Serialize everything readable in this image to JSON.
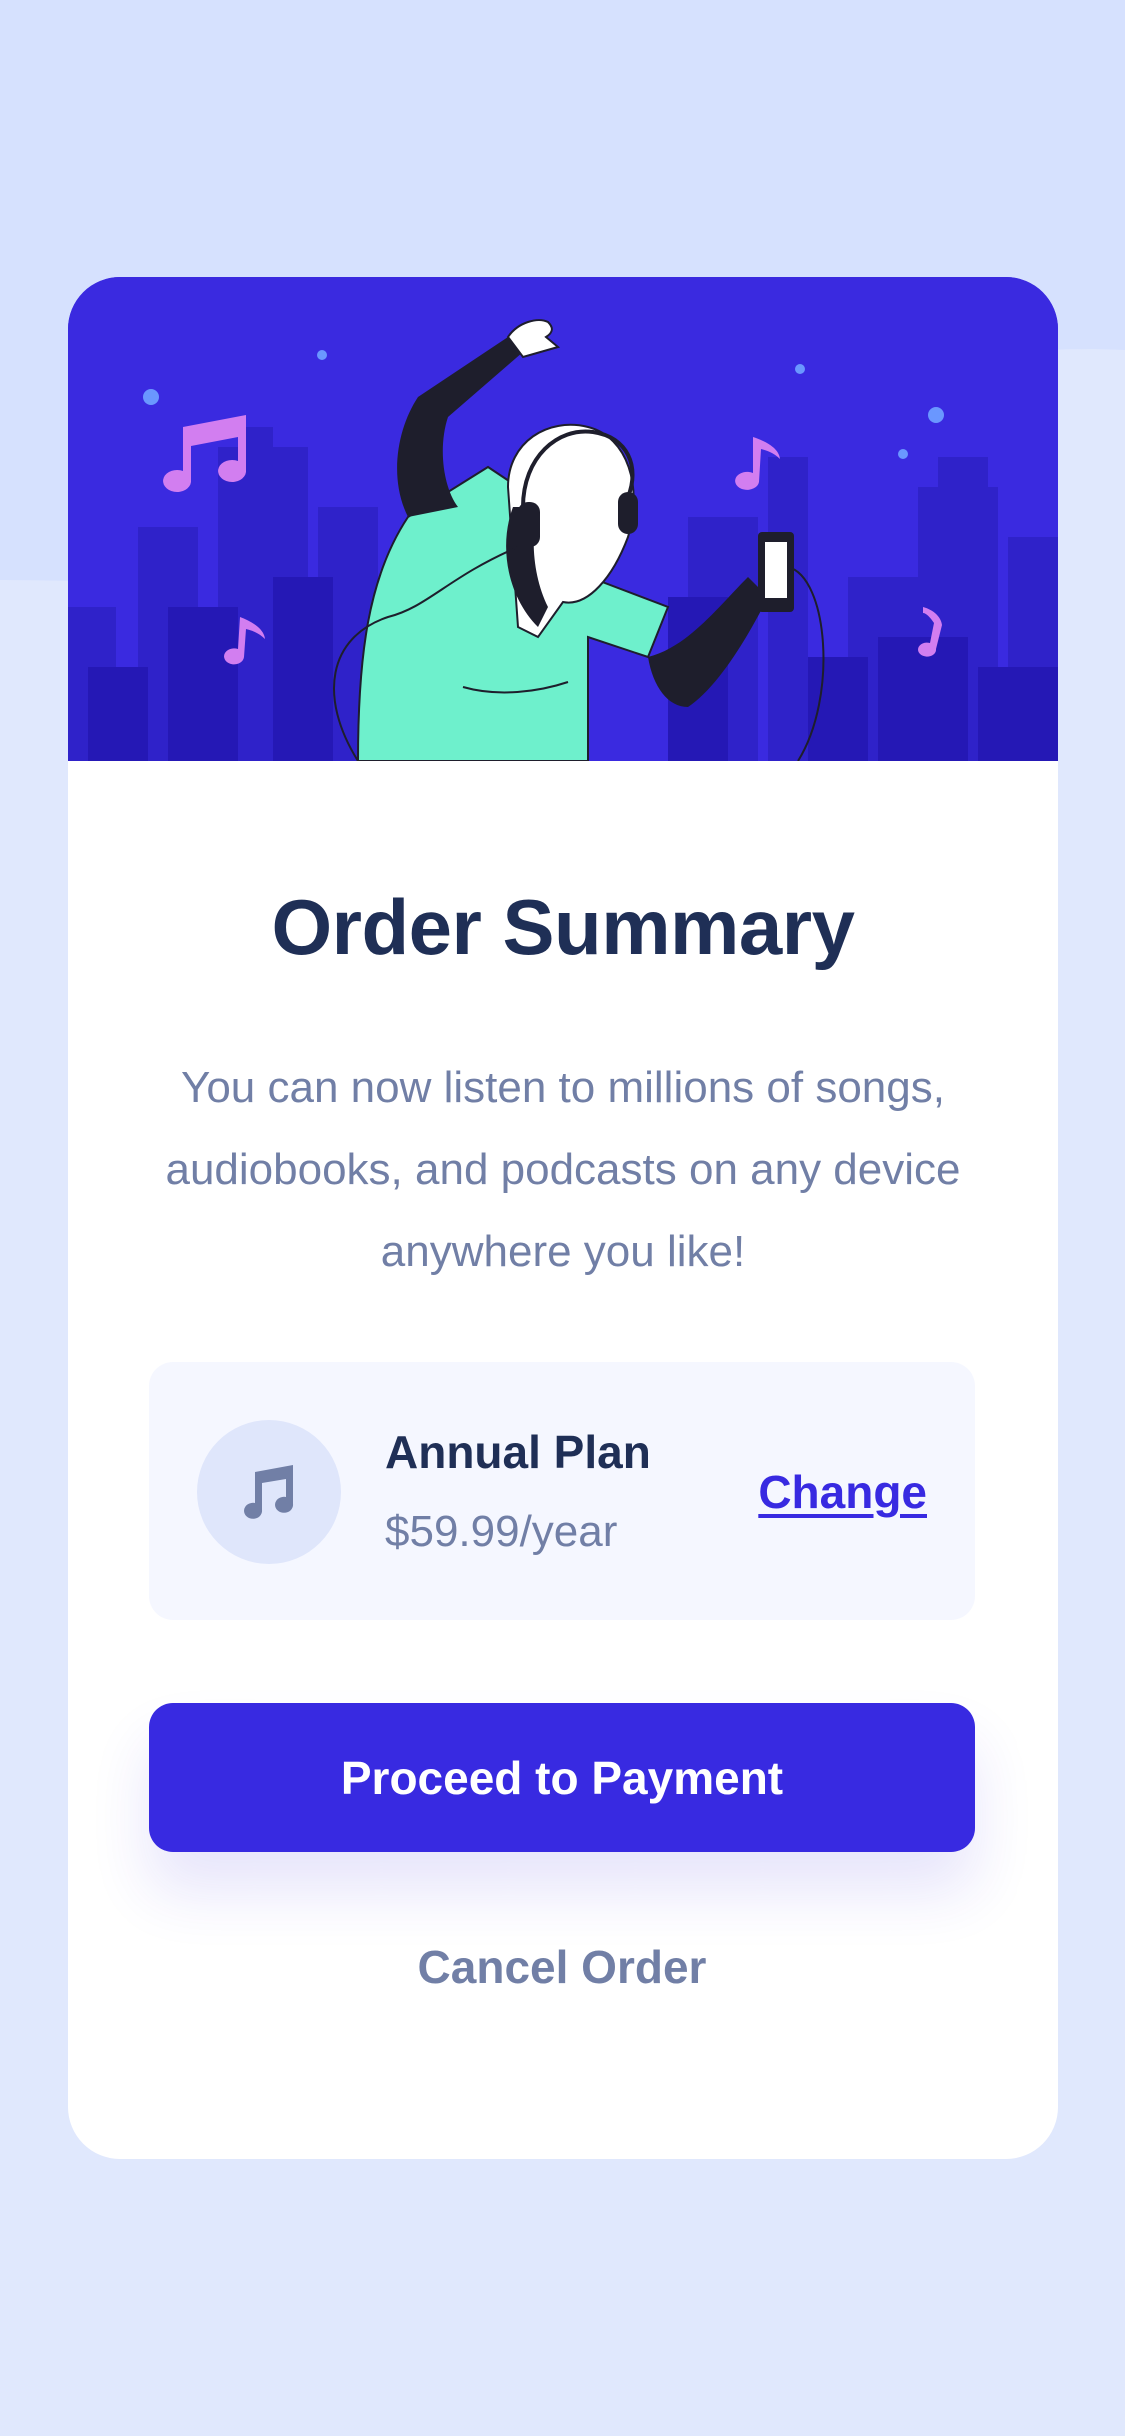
{
  "colors": {
    "page_background": "#e0e8fd",
    "hero_background": "#3a2ae0",
    "primary": "#382ae1",
    "heading": "#1f2f56",
    "body_text": "#717fa6",
    "plan_background": "#f5f7ff"
  },
  "hero": {
    "illustration": "woman-dancing-with-headphones-illustration"
  },
  "card": {
    "title": "Order Summary",
    "description": "You can now listen to millions of songs, audiobooks, and podcasts on any device anywhere you like!"
  },
  "plan": {
    "icon": "music-note-icon",
    "name": "Annual Plan",
    "price": "$59.99/year",
    "change_label": "Change"
  },
  "actions": {
    "proceed_label": "Proceed to Payment",
    "cancel_label": "Cancel Order"
  }
}
